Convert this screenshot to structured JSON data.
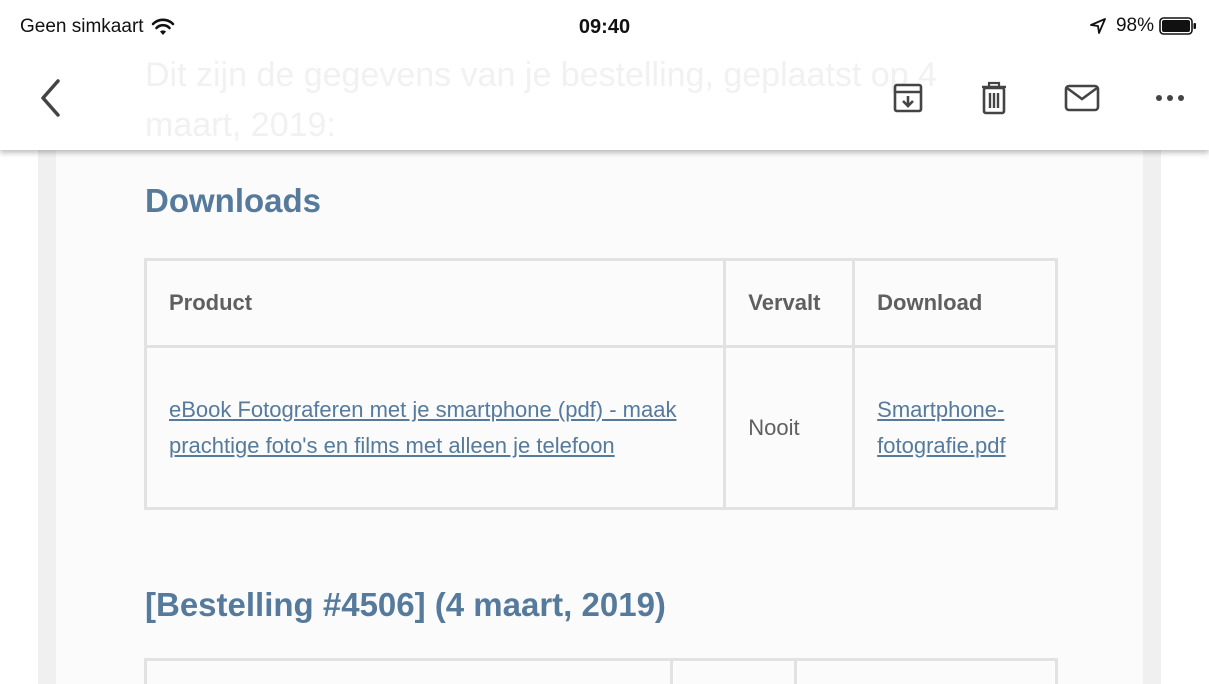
{
  "status_bar": {
    "carrier": "Geen simkaart",
    "time": "09:40",
    "battery": "98%"
  },
  "header": {
    "scrolled_text": "Dit zijn de gegevens van je bestelling, geplaatst op 4 maart, 2019:",
    "icons": [
      "back-icon",
      "archive-icon",
      "trash-icon",
      "mail-icon",
      "more-icon"
    ]
  },
  "email": {
    "downloads_title": "Downloads",
    "downloads_table": {
      "headers": [
        "Product",
        "Vervalt",
        "Download"
      ],
      "rows": [
        {
          "product": "eBook Fotograferen met je smartphone (pdf) - maak prachtige foto's en films met alleen je telefoon",
          "expires": "Nooit",
          "download": "Smartphone-fotografie.pdf"
        }
      ]
    },
    "order_title": "[Bestelling #4506] (4 maart, 2019)"
  },
  "colors": {
    "accent": "#557a9c",
    "text_muted": "#5f5f5f",
    "border": "#e2e2e2"
  }
}
